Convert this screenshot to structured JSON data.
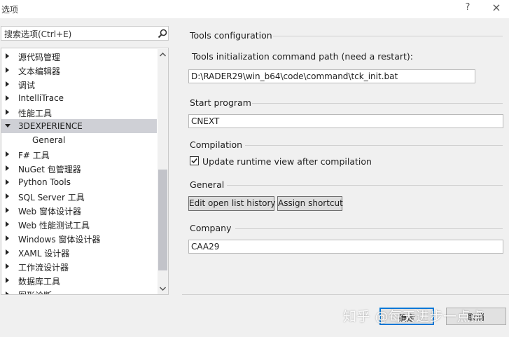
{
  "window": {
    "title": "选项",
    "help_glyph": "?",
    "close_glyph": "×"
  },
  "search": {
    "placeholder": "搜索选项(Ctrl+E)"
  },
  "tree": {
    "items": [
      {
        "label": "源代码管理",
        "expanded": false
      },
      {
        "label": "文本编辑器",
        "expanded": false
      },
      {
        "label": "调试",
        "expanded": false
      },
      {
        "label": "IntelliTrace",
        "expanded": false
      },
      {
        "label": "性能工具",
        "expanded": false
      },
      {
        "label": "3DEXPERIENCE",
        "expanded": true,
        "selected": true
      },
      {
        "label": "General",
        "child": true
      },
      {
        "label": "F# 工具",
        "expanded": false
      },
      {
        "label": "NuGet 包管理器",
        "expanded": false
      },
      {
        "label": "Python Tools",
        "expanded": false
      },
      {
        "label": "SQL Server 工具",
        "expanded": false
      },
      {
        "label": "Web 窗体设计器",
        "expanded": false
      },
      {
        "label": "Web 性能测试工具",
        "expanded": false
      },
      {
        "label": "Windows 窗体设计器",
        "expanded": false
      },
      {
        "label": "XAML 设计器",
        "expanded": false
      },
      {
        "label": "工作流设计器",
        "expanded": false
      },
      {
        "label": "数据库工具",
        "expanded": false
      },
      {
        "label": "图形诊断",
        "expanded": false
      }
    ]
  },
  "tools_config": {
    "title": "Tools configuration",
    "init_path_label": "Tools initialization command path (need a restart):",
    "init_path_value": "D:\\RADER29\\win_b64\\code\\command\\tck_init.bat"
  },
  "start_program": {
    "title": "Start program",
    "value": "CNEXT"
  },
  "compilation": {
    "title": "Compilation",
    "checkbox_label": "Update runtime view after compilation",
    "checked": true
  },
  "general": {
    "title": "General",
    "edit_history_label": "Edit open list history",
    "assign_shortcut_label": "Assign shortcut"
  },
  "company": {
    "title": "Company",
    "value": "CAA29"
  },
  "footer": {
    "ok_label": "确定",
    "cancel_label": "取消",
    "watermark": "知乎 @每天进步一点点"
  },
  "colors": {
    "accent": "#0078d7",
    "selected_row": "#cfd0d6",
    "background": "#f0f0f0"
  }
}
